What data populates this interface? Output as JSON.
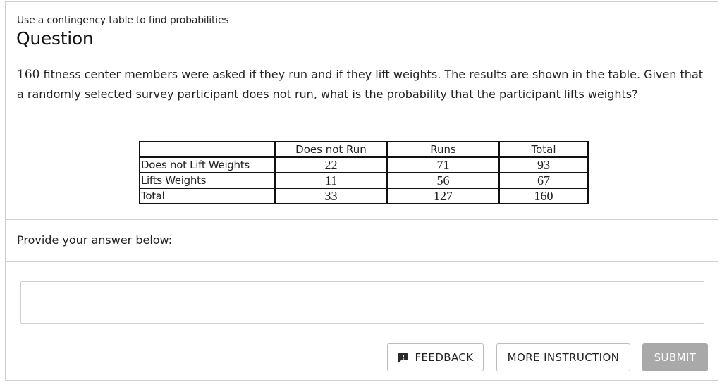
{
  "header": {
    "topic": "Use a contingency table to find probabilities",
    "title": "Question"
  },
  "question": {
    "lead_number": "160",
    "text": " fitness center members were asked if they run and if they lift weights. The results are shown in the table. Given that a randomly selected survey participant does not run, what is the probability that the participant lifts weights?"
  },
  "table": {
    "columns": [
      "Does not Run",
      "Runs",
      "Total"
    ],
    "rows": [
      {
        "label": "Does not Lift Weights",
        "values": [
          "22",
          "71",
          "93"
        ]
      },
      {
        "label": "Lifts Weights",
        "values": [
          "11",
          "56",
          "67"
        ]
      },
      {
        "label": "Total",
        "values": [
          "33",
          "127",
          "160"
        ]
      }
    ]
  },
  "answer": {
    "prompt": "Provide your answer below:",
    "value": ""
  },
  "buttons": {
    "feedback": "FEEDBACK",
    "more_instruction": "MORE INSTRUCTION",
    "submit": "SUBMIT"
  },
  "icons": {
    "feedback": "feedback-speech-bubble-icon"
  },
  "colors": {
    "submit_bg": "#a9a9a9",
    "border": "#cfcfcf"
  }
}
